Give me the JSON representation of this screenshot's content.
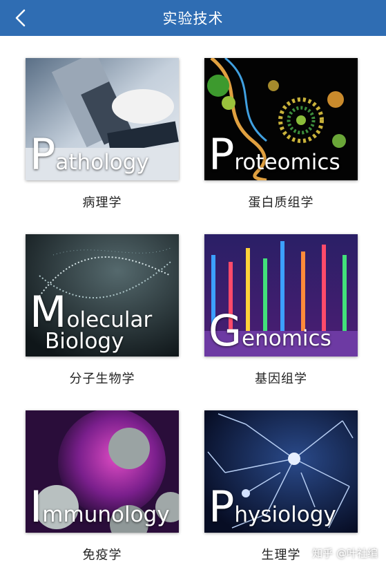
{
  "header": {
    "title": "实验技术",
    "back_icon": "chevron-left-icon",
    "bg_color": "#2f6db3"
  },
  "cards": [
    {
      "overlay_initial": "P",
      "overlay_rest": "athology",
      "caption": "病理学"
    },
    {
      "overlay_initial": "P",
      "overlay_rest": "roteomics",
      "caption": "蛋白质组学"
    },
    {
      "overlay_initial": "M",
      "overlay_rest": "olecular",
      "overlay_line2": "Biology",
      "caption": "分子生物学"
    },
    {
      "overlay_initial": "G",
      "overlay_rest": "enomics",
      "caption": "基因组学"
    },
    {
      "overlay_initial": "I",
      "overlay_rest": "mmunology",
      "caption": "免疫学"
    },
    {
      "overlay_initial": "P",
      "overlay_rest": "hysiology",
      "caption": "生理学"
    }
  ],
  "watermark": "知乎 @叶社编"
}
